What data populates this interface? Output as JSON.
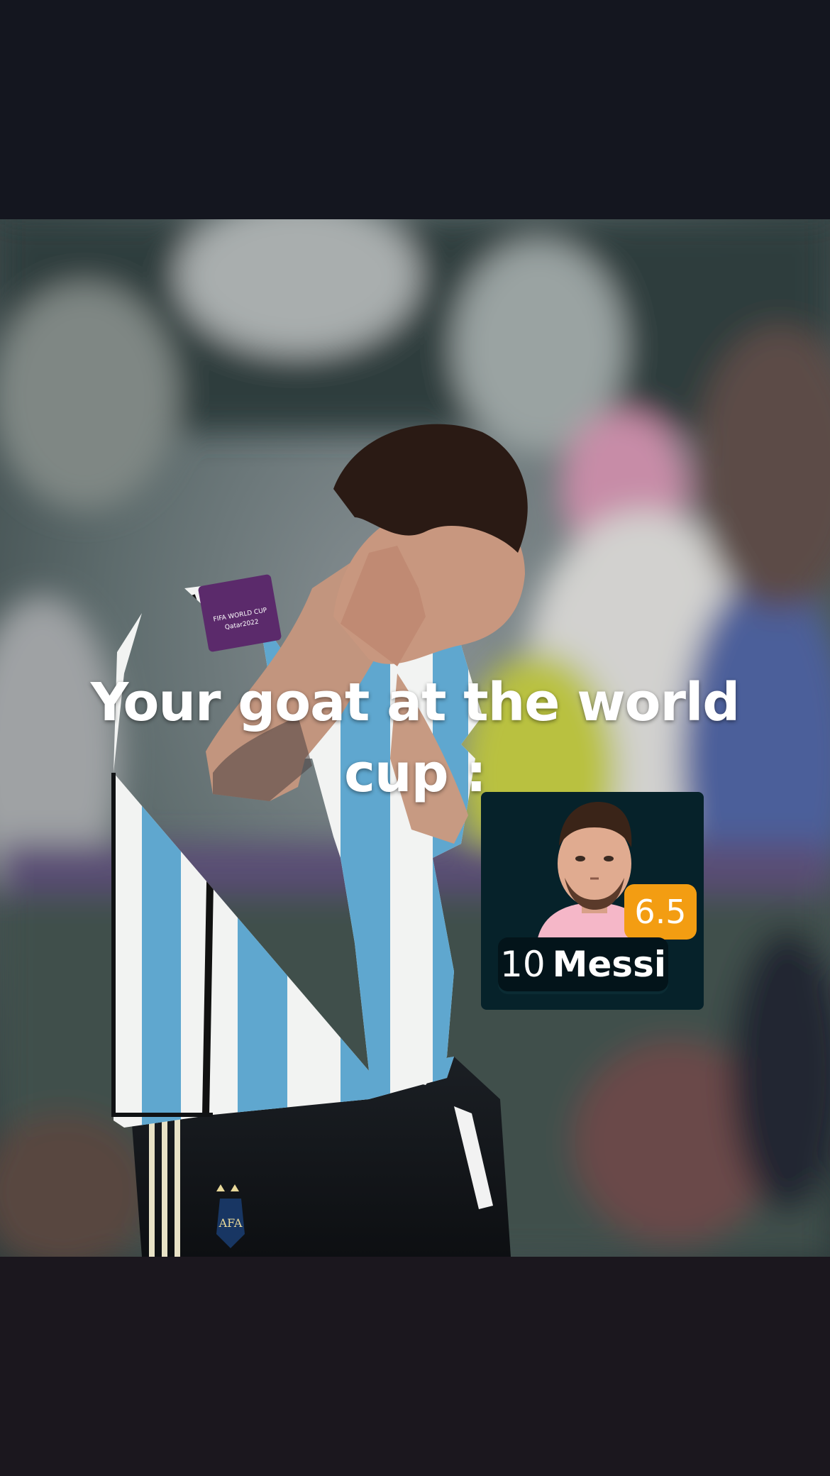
{
  "caption": {
    "line1": "Your goat at the world",
    "line2": "cup :"
  },
  "player_card": {
    "rating": "6.5",
    "shirt_number": "10",
    "name": "Messi",
    "colors": {
      "card_background": "#06222a",
      "rating_badge": "#f39d12",
      "name_plate": "#03141a"
    }
  },
  "photo": {
    "subject": "footballer-face-covered-icon",
    "badge_text": "FIFA WORLD CUP Qatar2022",
    "crest_text": "AFA"
  }
}
